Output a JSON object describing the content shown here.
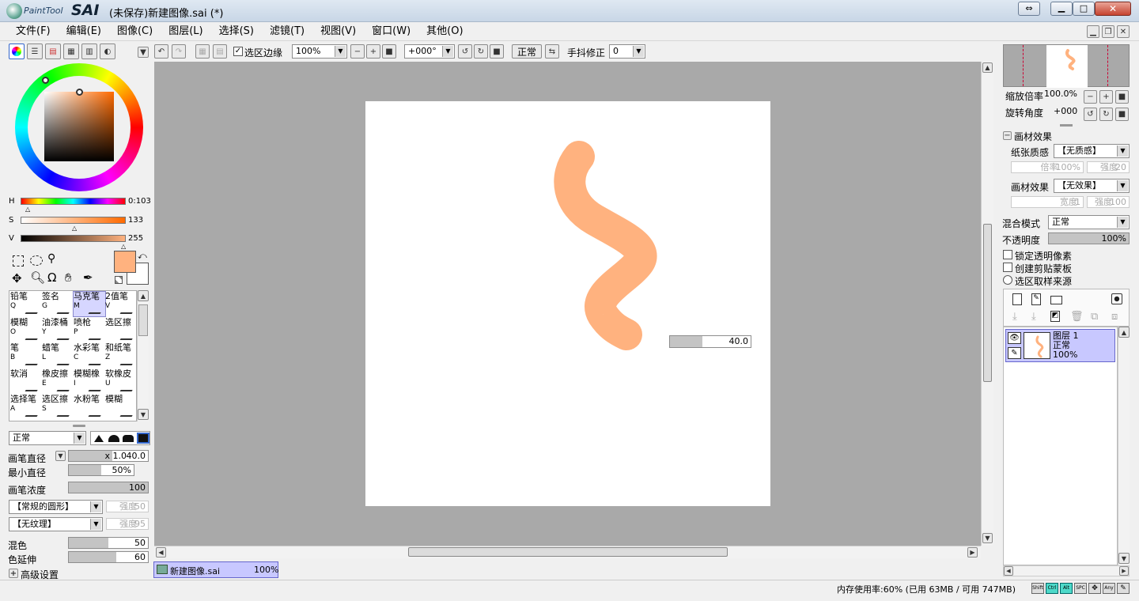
{
  "app": {
    "logo_text": "PaintTool",
    "logo_sai": "SAI",
    "title": "(未保存)新建图像.sai (*)"
  },
  "menu": [
    {
      "label": "文件(F)"
    },
    {
      "label": "编辑(E)"
    },
    {
      "label": "图像(C)"
    },
    {
      "label": "图层(L)"
    },
    {
      "label": "选择(S)"
    },
    {
      "label": "滤镜(T)"
    },
    {
      "label": "视图(V)"
    },
    {
      "label": "窗口(W)"
    },
    {
      "label": "其他(O)"
    }
  ],
  "toolbar": {
    "select_edge_label": "选区边缘",
    "zoom_value": "100%",
    "rotation_value": "+000°",
    "blend_label": "正常",
    "stabilizer_label": "手抖修正",
    "stabilizer_value": "0"
  },
  "color": {
    "h_label": "H",
    "h_value": "0:103",
    "s_label": "S",
    "s_value": "133",
    "v_label": "V",
    "v_value": "255",
    "fg": "#FFB27F",
    "bg": "#FFFFFF"
  },
  "tools": [
    {
      "name": "铅笔",
      "key": "Q"
    },
    {
      "name": "签名",
      "key": "G"
    },
    {
      "name": "马克笔",
      "key": "M"
    },
    {
      "name": "2值笔",
      "key": "V"
    },
    {
      "name": "模糊",
      "key": "O"
    },
    {
      "name": "油漆桶",
      "key": "Y"
    },
    {
      "name": "喷枪",
      "key": "P"
    },
    {
      "name": "选区擦",
      "key": ""
    },
    {
      "name": "笔",
      "key": "B"
    },
    {
      "name": "蜡笔",
      "key": "L"
    },
    {
      "name": "水彩笔",
      "key": "C"
    },
    {
      "name": "和纸笔",
      "key": "Z"
    },
    {
      "name": "软消",
      "key": ""
    },
    {
      "name": "橡皮擦",
      "key": "E"
    },
    {
      "name": "模糊橡",
      "key": "I"
    },
    {
      "name": "软橡皮",
      "key": "U"
    },
    {
      "name": "选择笔",
      "key": "A"
    },
    {
      "name": "选区擦",
      "key": "S"
    },
    {
      "name": "水粉笔",
      "key": ""
    },
    {
      "name": "模糊",
      "key": ""
    }
  ],
  "brush": {
    "mode": "正常",
    "size_label": "画笔直径",
    "size_mult": "x 1.0",
    "size_value": "40.0",
    "size_pct": 0.55,
    "min_label": "最小直径",
    "min_value": "50%",
    "min_pct": 0.5,
    "density_label": "画笔浓度",
    "density_value": "100",
    "density_pct": 1.0,
    "shape": "【常规的圆形】",
    "shape_strength_label": "强度",
    "shape_strength": "50",
    "texture": "【无纹理】",
    "texture_strength_label": "强度",
    "texture_strength": "95",
    "mix_label": "混色",
    "mix_value": "50",
    "mix_pct": 0.5,
    "extend_label": "色延伸",
    "extend_value": "60",
    "extend_pct": 0.6,
    "advanced_label": "高级设置"
  },
  "canvas": {
    "size_readout": "40.0",
    "stroke_color": "#FFB27F",
    "size_readout_pct": 0.4
  },
  "navigator": {
    "zoom_label": "缩放倍率",
    "zoom_value": "100.0%",
    "rotate_label": "旋转角度",
    "rotate_value": "+000"
  },
  "texture": {
    "header": "画材效果",
    "paper_label": "纸张质感",
    "paper_value": "【无质感】",
    "paper_scale_label": "倍率",
    "paper_scale_value": "100%",
    "paper_strength_label": "强度",
    "paper_strength_value": "20",
    "effect_label": "画材效果",
    "effect_value": "【无效果】",
    "effect_width_label": "宽度",
    "effect_width_value": "1",
    "effect_strength_label": "强度",
    "effect_strength_value": "100"
  },
  "layer_props": {
    "blend_label": "混合模式",
    "blend_value": "正常",
    "opacity_label": "不透明度",
    "opacity_value": "100%",
    "lock_label": "锁定透明像素",
    "clip_label": "创建剪贴蒙板",
    "sample_label": "选区取样来源"
  },
  "layers": [
    {
      "name": "图层 1",
      "mode": "正常",
      "opacity": "100%"
    }
  ],
  "doc_tab": {
    "name": "新建图像.sai",
    "zoom": "100%"
  },
  "status": {
    "memory": "内存使用率:60% (已用 63MB / 可用 747MB)",
    "keys": [
      "Shift",
      "Ctrl",
      "Alt",
      "SPC",
      "Any"
    ]
  }
}
